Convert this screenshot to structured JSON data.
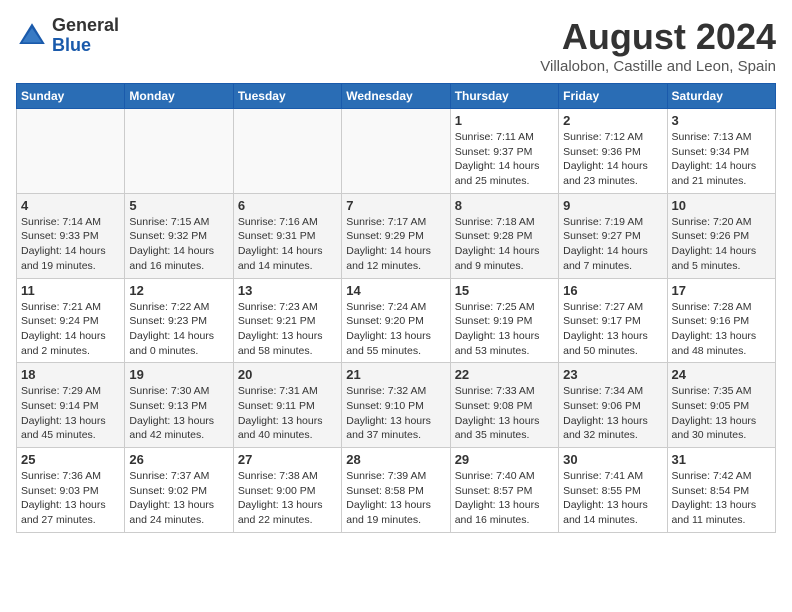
{
  "header": {
    "logo_general": "General",
    "logo_blue": "Blue",
    "month": "August 2024",
    "location": "Villalobon, Castille and Leon, Spain"
  },
  "weekdays": [
    "Sunday",
    "Monday",
    "Tuesday",
    "Wednesday",
    "Thursday",
    "Friday",
    "Saturday"
  ],
  "weeks": [
    [
      {
        "day": "",
        "info": ""
      },
      {
        "day": "",
        "info": ""
      },
      {
        "day": "",
        "info": ""
      },
      {
        "day": "",
        "info": ""
      },
      {
        "day": "1",
        "info": "Sunrise: 7:11 AM\nSunset: 9:37 PM\nDaylight: 14 hours\nand 25 minutes."
      },
      {
        "day": "2",
        "info": "Sunrise: 7:12 AM\nSunset: 9:36 PM\nDaylight: 14 hours\nand 23 minutes."
      },
      {
        "day": "3",
        "info": "Sunrise: 7:13 AM\nSunset: 9:34 PM\nDaylight: 14 hours\nand 21 minutes."
      }
    ],
    [
      {
        "day": "4",
        "info": "Sunrise: 7:14 AM\nSunset: 9:33 PM\nDaylight: 14 hours\nand 19 minutes."
      },
      {
        "day": "5",
        "info": "Sunrise: 7:15 AM\nSunset: 9:32 PM\nDaylight: 14 hours\nand 16 minutes."
      },
      {
        "day": "6",
        "info": "Sunrise: 7:16 AM\nSunset: 9:31 PM\nDaylight: 14 hours\nand 14 minutes."
      },
      {
        "day": "7",
        "info": "Sunrise: 7:17 AM\nSunset: 9:29 PM\nDaylight: 14 hours\nand 12 minutes."
      },
      {
        "day": "8",
        "info": "Sunrise: 7:18 AM\nSunset: 9:28 PM\nDaylight: 14 hours\nand 9 minutes."
      },
      {
        "day": "9",
        "info": "Sunrise: 7:19 AM\nSunset: 9:27 PM\nDaylight: 14 hours\nand 7 minutes."
      },
      {
        "day": "10",
        "info": "Sunrise: 7:20 AM\nSunset: 9:26 PM\nDaylight: 14 hours\nand 5 minutes."
      }
    ],
    [
      {
        "day": "11",
        "info": "Sunrise: 7:21 AM\nSunset: 9:24 PM\nDaylight: 14 hours\nand 2 minutes."
      },
      {
        "day": "12",
        "info": "Sunrise: 7:22 AM\nSunset: 9:23 PM\nDaylight: 14 hours\nand 0 minutes."
      },
      {
        "day": "13",
        "info": "Sunrise: 7:23 AM\nSunset: 9:21 PM\nDaylight: 13 hours\nand 58 minutes."
      },
      {
        "day": "14",
        "info": "Sunrise: 7:24 AM\nSunset: 9:20 PM\nDaylight: 13 hours\nand 55 minutes."
      },
      {
        "day": "15",
        "info": "Sunrise: 7:25 AM\nSunset: 9:19 PM\nDaylight: 13 hours\nand 53 minutes."
      },
      {
        "day": "16",
        "info": "Sunrise: 7:27 AM\nSunset: 9:17 PM\nDaylight: 13 hours\nand 50 minutes."
      },
      {
        "day": "17",
        "info": "Sunrise: 7:28 AM\nSunset: 9:16 PM\nDaylight: 13 hours\nand 48 minutes."
      }
    ],
    [
      {
        "day": "18",
        "info": "Sunrise: 7:29 AM\nSunset: 9:14 PM\nDaylight: 13 hours\nand 45 minutes."
      },
      {
        "day": "19",
        "info": "Sunrise: 7:30 AM\nSunset: 9:13 PM\nDaylight: 13 hours\nand 42 minutes."
      },
      {
        "day": "20",
        "info": "Sunrise: 7:31 AM\nSunset: 9:11 PM\nDaylight: 13 hours\nand 40 minutes."
      },
      {
        "day": "21",
        "info": "Sunrise: 7:32 AM\nSunset: 9:10 PM\nDaylight: 13 hours\nand 37 minutes."
      },
      {
        "day": "22",
        "info": "Sunrise: 7:33 AM\nSunset: 9:08 PM\nDaylight: 13 hours\nand 35 minutes."
      },
      {
        "day": "23",
        "info": "Sunrise: 7:34 AM\nSunset: 9:06 PM\nDaylight: 13 hours\nand 32 minutes."
      },
      {
        "day": "24",
        "info": "Sunrise: 7:35 AM\nSunset: 9:05 PM\nDaylight: 13 hours\nand 30 minutes."
      }
    ],
    [
      {
        "day": "25",
        "info": "Sunrise: 7:36 AM\nSunset: 9:03 PM\nDaylight: 13 hours\nand 27 minutes."
      },
      {
        "day": "26",
        "info": "Sunrise: 7:37 AM\nSunset: 9:02 PM\nDaylight: 13 hours\nand 24 minutes."
      },
      {
        "day": "27",
        "info": "Sunrise: 7:38 AM\nSunset: 9:00 PM\nDaylight: 13 hours\nand 22 minutes."
      },
      {
        "day": "28",
        "info": "Sunrise: 7:39 AM\nSunset: 8:58 PM\nDaylight: 13 hours\nand 19 minutes."
      },
      {
        "day": "29",
        "info": "Sunrise: 7:40 AM\nSunset: 8:57 PM\nDaylight: 13 hours\nand 16 minutes."
      },
      {
        "day": "30",
        "info": "Sunrise: 7:41 AM\nSunset: 8:55 PM\nDaylight: 13 hours\nand 14 minutes."
      },
      {
        "day": "31",
        "info": "Sunrise: 7:42 AM\nSunset: 8:54 PM\nDaylight: 13 hours\nand 11 minutes."
      }
    ]
  ]
}
